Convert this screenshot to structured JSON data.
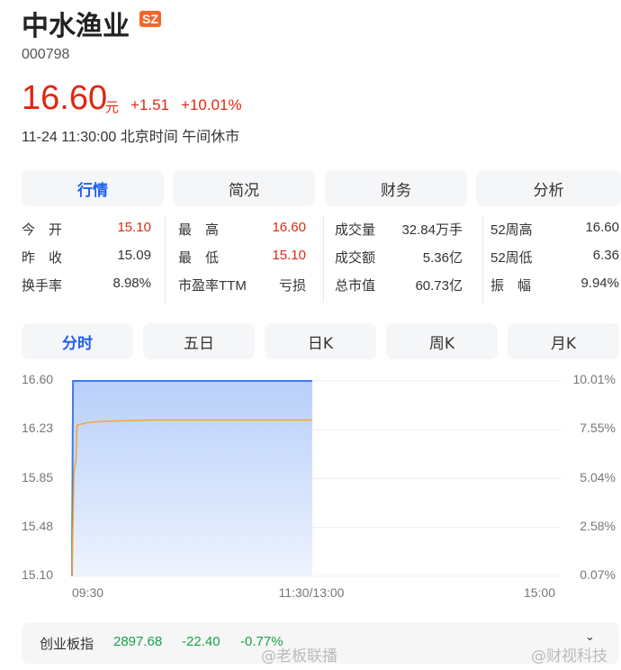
{
  "stock": {
    "name": "中水渔业",
    "exchange": "SZ",
    "code": "000798",
    "price": "16.60",
    "unit": "元",
    "change": "+1.51",
    "change_pct": "+10.01%",
    "time": "11-24 11:30:00 北京时间 午间休市"
  },
  "tabs": [
    {
      "label": "行情",
      "active": true
    },
    {
      "label": "简况"
    },
    {
      "label": "财务"
    },
    {
      "label": "分析"
    }
  ],
  "quote": {
    "col1": [
      {
        "label": "今　开",
        "value": "15.10",
        "red": true
      },
      {
        "label": "昨　收",
        "value": "15.09"
      },
      {
        "label": "换手率",
        "value": "8.98%"
      }
    ],
    "col2": [
      {
        "label": "最　高",
        "value": "16.60",
        "red": true
      },
      {
        "label": "最　低",
        "value": "15.10",
        "red": true
      },
      {
        "label": "市盈率TTM",
        "value": "亏损"
      }
    ],
    "col3": [
      {
        "label": "成交量",
        "value": "32.84万手"
      },
      {
        "label": "成交额",
        "value": "5.36亿"
      },
      {
        "label": "总市值",
        "value": "60.73亿"
      }
    ],
    "col4": [
      {
        "label": "52周高",
        "value": "16.60"
      },
      {
        "label": "52周低",
        "value": "6.36"
      },
      {
        "label": "振　幅",
        "value": "9.94%"
      }
    ]
  },
  "chart_tabs": [
    {
      "label": "分时",
      "active": true
    },
    {
      "label": "五日"
    },
    {
      "label": "日K"
    },
    {
      "label": "周K"
    },
    {
      "label": "月K"
    }
  ],
  "chart_data": {
    "type": "line",
    "x_unit": "minutes since 09:30 (trading)",
    "xlim": [
      0,
      240
    ],
    "ylim": [
      15.1,
      16.6
    ],
    "y_ticks": [
      "16.60",
      "16.23",
      "15.85",
      "15.48",
      "15.10"
    ],
    "y_right_ticks": [
      "10.01%",
      "7.55%",
      "5.04%",
      "2.58%",
      "0.07%"
    ],
    "x_ticks": [
      "09:30",
      "11:30/13:00",
      "15:00"
    ],
    "series": [
      {
        "name": "price",
        "color": "#3d7bf0",
        "points": [
          [
            0,
            15.1
          ],
          [
            0.5,
            16.6
          ],
          [
            120,
            16.6
          ]
        ]
      },
      {
        "name": "avg",
        "color": "#f5a623",
        "points": [
          [
            0,
            15.1
          ],
          [
            1,
            15.9
          ],
          [
            2,
            16.0
          ],
          [
            2.5,
            16.26
          ],
          [
            5,
            16.27
          ],
          [
            8,
            16.28
          ],
          [
            15,
            16.29
          ],
          [
            40,
            16.3
          ],
          [
            120,
            16.3
          ]
        ]
      }
    ]
  },
  "index": {
    "name": "创业板指",
    "value": "2897.68",
    "change": "-22.40",
    "change_pct": "-0.77%"
  },
  "watermarks": [
    "@老板联播",
    "@财视科技"
  ]
}
